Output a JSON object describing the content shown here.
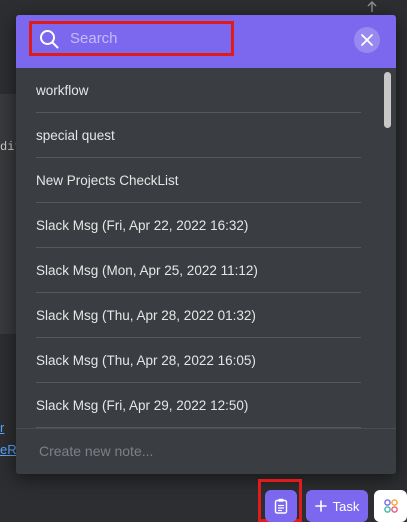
{
  "search": {
    "placeholder": "Search"
  },
  "notes": [
    "workflow",
    "special quest",
    "New Projects CheckList",
    "Slack Msg (Fri, Apr 22, 2022 16:32)",
    "Slack Msg (Mon, Apr 25, 2022 11:12)",
    "Slack Msg (Thu, Apr 28, 2022 01:32)",
    "Slack Msg (Thu, Apr 28, 2022 16:05)",
    "Slack Msg (Fri, Apr 29, 2022 12:50)"
  ],
  "new_note": {
    "placeholder": "Create new note..."
  },
  "bottom_bar": {
    "task_label": "Task"
  },
  "background": {
    "code_fragment": "dit",
    "link_1": "r",
    "link_2": "eR"
  },
  "colors": {
    "accent": "#7b68ee",
    "popover_bg": "#3a3d41",
    "highlight": "#e01b1b"
  },
  "icons": {
    "search": "search-icon",
    "close": "close-icon",
    "notepad": "notepad-icon",
    "plus": "plus-icon",
    "apps": "apps-grid-icon"
  }
}
